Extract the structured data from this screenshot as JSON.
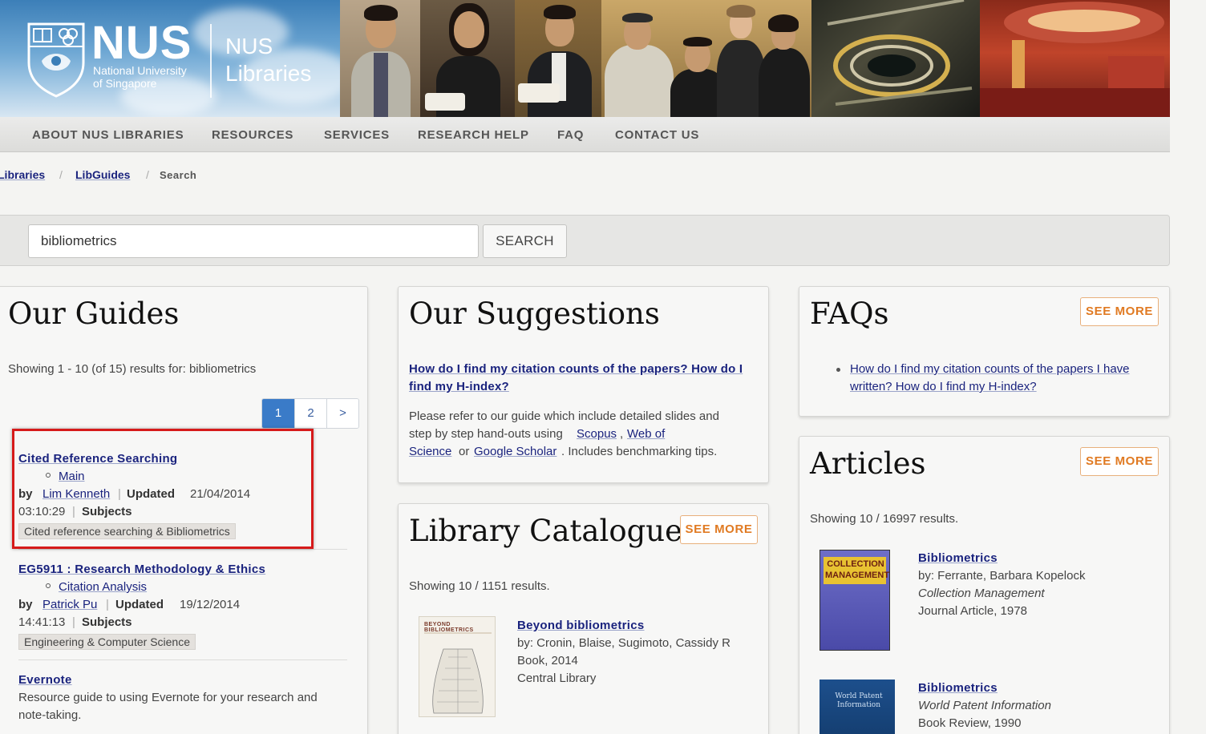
{
  "banner": {
    "logo_word": "NUS",
    "logo_line1": "National University",
    "logo_line2": "of Singapore",
    "library_line1": "NUS",
    "library_line2": "Libraries"
  },
  "nav": {
    "items": [
      "ABOUT NUS LIBRARIES",
      "RESOURCES",
      "SERVICES",
      "RESEARCH HELP",
      "FAQ",
      "CONTACT US"
    ]
  },
  "breadcrumb": {
    "items": [
      "Libraries",
      "LibGuides"
    ],
    "separator": "/",
    "current": "Search"
  },
  "search": {
    "value": "bibliometrics",
    "button_label": "SEARCH"
  },
  "guides": {
    "title": "Our Guides",
    "showing": "Showing 1 - 10 (of 15) results for: bibliometrics",
    "pagination": [
      "1",
      "2",
      ">"
    ],
    "by_label": "by",
    "updated_label": "Updated",
    "subjects_label": "Subjects",
    "results": [
      {
        "title": "Cited Reference Searching",
        "page": "Main",
        "author": "Lim Kenneth",
        "date": "21/04/2014",
        "time": "03:10:29",
        "subject": "Cited reference searching & Bibliometrics"
      },
      {
        "title": "EG5911 : Research Methodology & Ethics",
        "page": "Citation Analysis",
        "author": "Patrick Pu",
        "date": "19/12/2014",
        "time": "14:41:13",
        "subject": "Engineering & Computer Science"
      },
      {
        "title": "Evernote",
        "description_line1": "Resource guide to using Evernote for your research and",
        "description_line2": "note-taking."
      }
    ]
  },
  "suggestions": {
    "title": "Our Suggestions",
    "link_line1": "How do I find my citation counts of the papers? How do I",
    "link_line2": "find my H-index?",
    "desc_line1": "Please refer to our guide which include detailed slides and",
    "desc_line2_pre": "step by step hand-outs using",
    "scopus": "Scopus",
    "comma": ",",
    "wos_part1": "Web of",
    "wos_part2": "Science",
    "or": "or",
    "google_scholar": "Google Scholar",
    "desc_tail": ". Includes benchmarking tips."
  },
  "catalogue": {
    "title": "Library Catalogue",
    "see_more": "SEE MORE",
    "showing": "Showing 10 / 1151 results.",
    "items": [
      {
        "title": "Beyond bibliometrics",
        "by": "by: Cronin, Blaise, Sugimoto, Cassidy R",
        "type": "Book, 2014",
        "location": "Central Library",
        "cover_text": "BEYOND BIBLIOMETRICS"
      }
    ]
  },
  "faqs": {
    "title": "FAQs",
    "see_more": "SEE MORE",
    "link_line1": "How do I find my citation counts of the papers I have",
    "link_line2": "written? How do I find my H-index?"
  },
  "articles": {
    "title": "Articles",
    "see_more": "SEE MORE",
    "showing": "Showing 10 / 16997 results.",
    "items": [
      {
        "title": "Bibliometrics",
        "by": "by: Ferrante, Barbara Kopelock",
        "journal": "Collection Management",
        "type": "Journal Article, 1978",
        "cover_text": "COLLECTION MANAGEMENT"
      },
      {
        "title": "Bibliometrics",
        "journal": "World Patent Information",
        "type": "Book Review, 1990",
        "cover_text": "World Patent Information"
      }
    ]
  },
  "colors": {
    "link": "#1a237e",
    "accent_orange": "#e07a22",
    "pager_active": "#3a7bc8",
    "highlight_red": "#d61a1a"
  }
}
